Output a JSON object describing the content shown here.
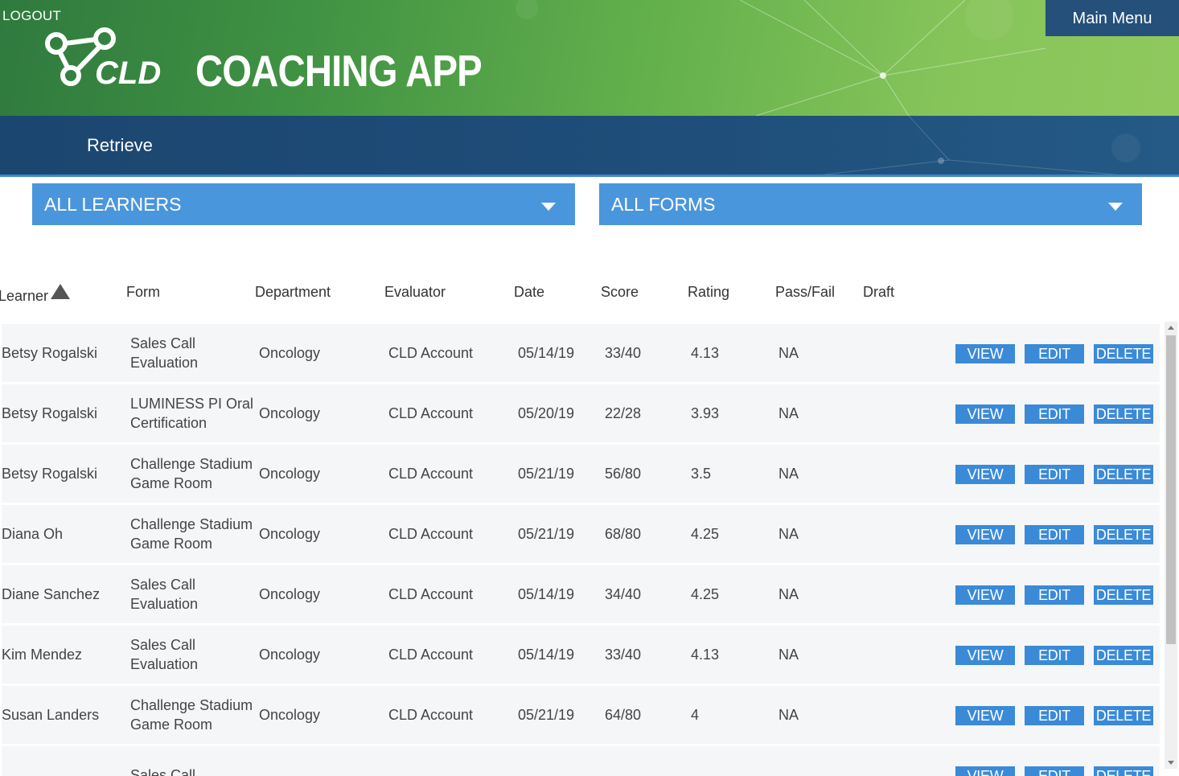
{
  "header": {
    "logout_label": "LOGOUT",
    "logo_text": "CLD",
    "app_title": "COACHING APP",
    "main_menu_label": "Main Menu"
  },
  "subnav": {
    "title": "Retrieve"
  },
  "filters": {
    "learners": {
      "selected": "ALL LEARNERS"
    },
    "forms": {
      "selected": "ALL FORMS"
    }
  },
  "table": {
    "columns": [
      "Learner",
      "Form",
      "Department",
      "Evaluator",
      "Date",
      "Score",
      "Rating",
      "Pass/Fail",
      "Draft"
    ],
    "sort": {
      "column": "Learner",
      "direction": "ascending"
    },
    "rows": [
      {
        "learner": "Betsy Rogalski",
        "form": "Sales Call Evaluation",
        "department": "Oncology",
        "evaluator": "CLD Account",
        "date": "05/14/19",
        "score": "33/40",
        "rating": "4.13",
        "pass_fail": "NA",
        "draft": ""
      },
      {
        "learner": "Betsy Rogalski",
        "form": "LUMINESS PI Oral Certification",
        "department": "Oncology",
        "evaluator": "CLD Account",
        "date": "05/20/19",
        "score": "22/28",
        "rating": "3.93",
        "pass_fail": "NA",
        "draft": ""
      },
      {
        "learner": "Betsy Rogalski",
        "form": "Challenge Stadium Game Room",
        "department": "Oncology",
        "evaluator": "CLD Account",
        "date": "05/21/19",
        "score": "56/80",
        "rating": "3.5",
        "pass_fail": "NA",
        "draft": ""
      },
      {
        "learner": "Diana Oh",
        "form": "Challenge Stadium Game Room",
        "department": "Oncology",
        "evaluator": "CLD Account",
        "date": "05/21/19",
        "score": "68/80",
        "rating": "4.25",
        "pass_fail": "NA",
        "draft": ""
      },
      {
        "learner": "Diane Sanchez",
        "form": "Sales Call Evaluation",
        "department": "Oncology",
        "evaluator": "CLD Account",
        "date": "05/14/19",
        "score": "34/40",
        "rating": "4.25",
        "pass_fail": "NA",
        "draft": ""
      },
      {
        "learner": "Kim Mendez",
        "form": "Sales Call Evaluation",
        "department": "Oncology",
        "evaluator": "CLD Account",
        "date": "05/14/19",
        "score": "33/40",
        "rating": "4.13",
        "pass_fail": "NA",
        "draft": ""
      },
      {
        "learner": "Susan Landers",
        "form": "Challenge Stadium Game Room",
        "department": "Oncology",
        "evaluator": "CLD Account",
        "date": "05/21/19",
        "score": "64/80",
        "rating": "4",
        "pass_fail": "NA",
        "draft": ""
      },
      {
        "learner": "",
        "form": "Sales Call",
        "department": "",
        "evaluator": "",
        "date": "",
        "score": "",
        "rating": "",
        "pass_fail": "",
        "draft": ""
      }
    ],
    "actions": {
      "view": "VIEW",
      "edit": "EDIT",
      "delete": "DELETE"
    }
  },
  "icons": {
    "logo": "cld-molecule-logo-icon",
    "dropdown": "caret-down-icon",
    "sort": "sort-ascending-icon"
  },
  "colors": {
    "header_green": "#5aa84a",
    "nav_blue": "#1f4e7a",
    "dropdown_blue": "#4a96dc",
    "button_blue": "#3a8ad8",
    "menu_bg": "#24507a",
    "row_bg": "#f5f6f8"
  }
}
